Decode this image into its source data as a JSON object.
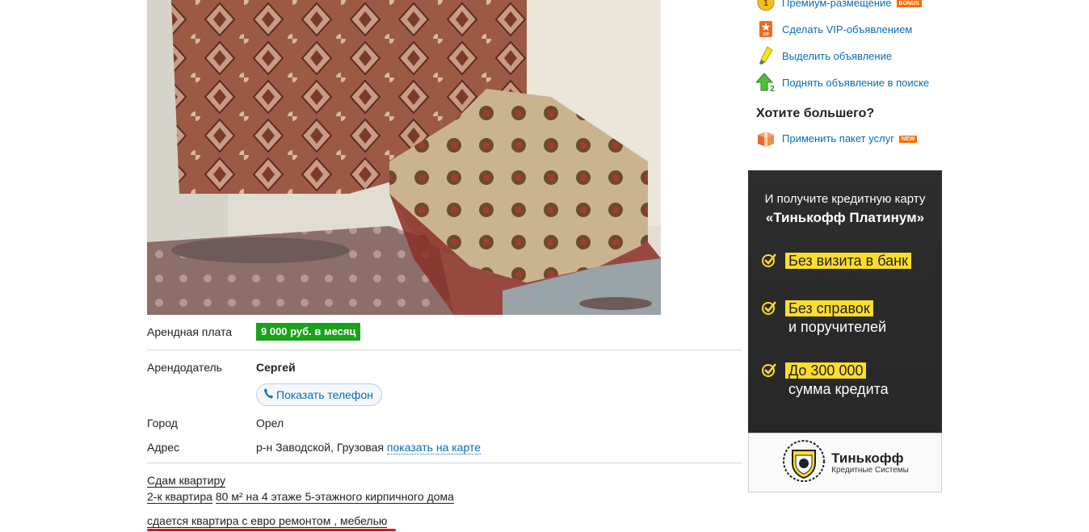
{
  "listing": {
    "price_label": "Арендная плата",
    "price_value": "9 000 руб. в месяц",
    "landlord_label": "Арендодатель",
    "landlord_name": "Сергей",
    "show_phone_label": "Показать телефон",
    "city_label": "Город",
    "city_value": "Орел",
    "address_label": "Адрес",
    "address_value": "р-н Заводской, Грузовая",
    "map_link": "показать на карте",
    "type_link": "Сдам квартиру",
    "rooms_link": "2-к квартира",
    "details_text": "80 м² на 4 этаже 5-этажного кирпичного дома",
    "description": "сдается квартира с евро ремонтом , мебелью"
  },
  "sidebar": {
    "services": [
      {
        "label": "Премиум-размещение",
        "badge": "BONUS",
        "icon": "premium-coin-icon"
      },
      {
        "label": "Сделать VIP-объявлением",
        "icon": "vip-icon"
      },
      {
        "label": "Выделить объявление",
        "icon": "highlighter-icon"
      },
      {
        "label": "Поднять объявление в поиске",
        "icon": "raise-up-icon"
      }
    ],
    "more_heading": "Хотите большего?",
    "package": {
      "label": "Применить пакет услуг",
      "badge": "NEW",
      "icon": "package-box-icon"
    }
  },
  "ad": {
    "heading_line1": "И получите кредитную карту",
    "heading_line2": "«Тинькофф Платинум»",
    "item1": "Без визита в банк",
    "item2_hl": "Без справок",
    "item2_rest": "и поручителей",
    "item3_hl": "До 300 000",
    "item3_rest": "сумма кредита",
    "brand_name": "Тинькофф",
    "brand_sub": "Кредитные Системы",
    "colors": {
      "accent": "#ffdd2d",
      "background": "#2d2d2d"
    }
  },
  "colors": {
    "link": "#0a6cb6",
    "price_badge": "#1aa31a",
    "red_underline": "#d21a1a"
  }
}
